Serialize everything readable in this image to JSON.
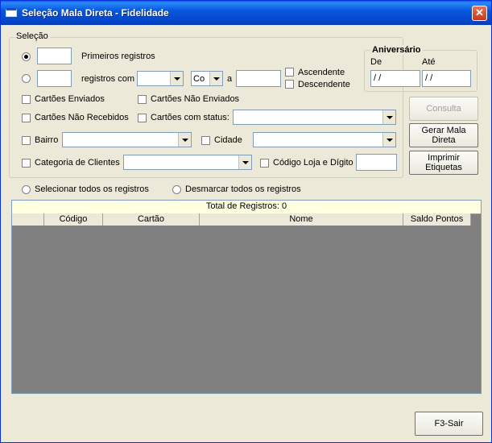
{
  "window": {
    "title": "Seleção Mala Direta - Fidelidade",
    "close_glyph": "✕"
  },
  "selecao": {
    "legend": "Seleção",
    "primeiros_registros": {
      "value": "",
      "label": "Primeiros registros",
      "selected": true
    },
    "registros_com": {
      "value": "",
      "label": "registros com",
      "field": "",
      "operator": "Co",
      "a_label": "a",
      "to_value": ""
    },
    "ordem": {
      "ascendente": "Ascendente",
      "descendente": "Descendente"
    },
    "checks": {
      "cartoes_enviados": "Cartões Enviados",
      "cartoes_nao_enviados": "Cartões Não Enviados",
      "cartoes_nao_recebidos": "Cartões Não Recebidos",
      "cartoes_com_status": "Cartões com status:",
      "bairro": "Bairro",
      "cidade": "Cidade",
      "categoria_clientes": "Categoria de Clientes",
      "codigo_loja": "Código Loja e Dígito"
    }
  },
  "aniversario": {
    "legend": "Aniversário",
    "de_label": "De",
    "ate_label": "Até",
    "de_value": " / /",
    "ate_value": " / /"
  },
  "buttons": {
    "consulta": "Consulta",
    "gerar_mala_direta": [
      "Gerar Mala",
      "Direta"
    ],
    "imprimir_etiquetas": [
      "Imprimir",
      "Etiquetas"
    ],
    "sair": "F3-Sair"
  },
  "radios_bottom": {
    "selecionar_todos": "Selecionar todos os registros",
    "desmarcar_todos": "Desmarcar todos os registros"
  },
  "grid": {
    "total": "Total de Registros: 0",
    "columns": [
      "Código",
      "Cartão",
      "Nome",
      "Saldo Pontos"
    ]
  },
  "colors": {
    "window_bg": "#ECE9D8",
    "titlebar": "#0758de",
    "grid_bg": "#808080",
    "total_bg": "#ffffe1"
  }
}
